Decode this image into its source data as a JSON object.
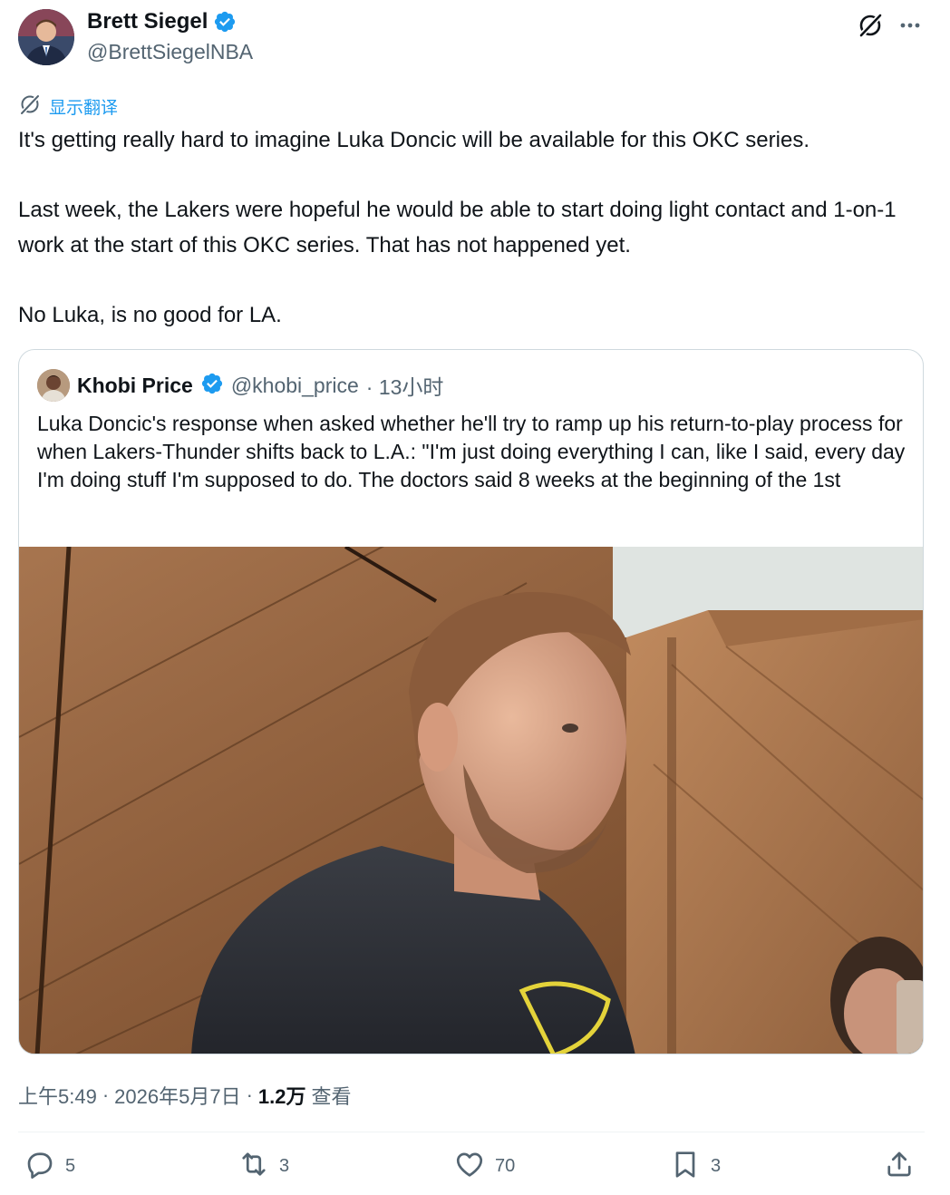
{
  "author": {
    "display_name": "Brett Siegel",
    "handle": "@BrettSiegelNBA",
    "verified": true
  },
  "translate_label": "显示翻译",
  "tweet_text": {
    "p1": "It's getting really hard to imagine Luka Doncic will be available for this OKC series.",
    "p2": "Last week, the Lakers were hopeful he would be able to start doing light contact and 1-on-1 work at the start of this OKC series. That has not happened yet.",
    "p3": "No Luka, is no good for LA."
  },
  "quote": {
    "display_name": "Khobi Price",
    "handle": "@khobi_price",
    "time": "· 13小时",
    "text": "Luka Doncic's response when asked whether he'll try to ramp up his return-to-play process for when Lakers-Thunder shifts back to L.A.: \"I'm just doing everything I can, like I said, every day I'm doing stuff I'm supposed to do. The doctors said 8 weeks at the beginning of the 1st"
  },
  "meta": {
    "time": "上午5:49",
    "sep1": "·",
    "date": "2026年5月7日",
    "sep2": "·",
    "views": "1.2万",
    "views_label": "查看"
  },
  "actions": {
    "replies": "5",
    "reposts": "3",
    "likes": "70",
    "bookmarks": "3"
  },
  "colors": {
    "accent": "#1d9bf0",
    "text": "#0f1419",
    "muted": "#536471",
    "border": "#cfd9de"
  },
  "icons": {
    "verified": "verified-badge-icon",
    "grok": "grok-icon",
    "more": "more-dots-icon",
    "translate": "translate-icon",
    "reply": "reply-icon",
    "repost": "repost-icon",
    "like": "heart-icon",
    "bookmark": "bookmark-icon",
    "share": "share-icon"
  }
}
